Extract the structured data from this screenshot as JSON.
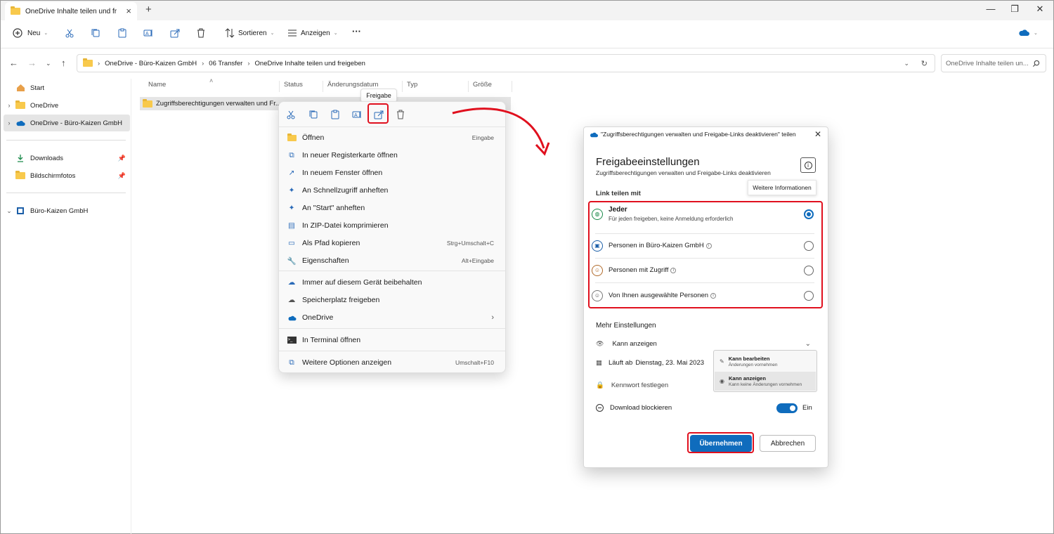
{
  "window": {
    "tab_title": "OneDrive Inhalte teilen und fr",
    "minimize": "—",
    "maximize": "❐",
    "close": "✕"
  },
  "toolbar": {
    "new_label": "Neu",
    "sort_label": "Sortieren",
    "view_label": "Anzeigen",
    "more_label": "···"
  },
  "address": {
    "crumbs": [
      "OneDrive - Büro-Kaizen GmbH",
      "06 Transfer",
      "OneDrive Inhalte teilen und freigeben"
    ],
    "search_placeholder": "OneDrive Inhalte teilen un..."
  },
  "sidebar": {
    "items": [
      {
        "label": "Start"
      },
      {
        "label": "OneDrive"
      },
      {
        "label": "OneDrive - Büro-Kaizen GmbH"
      },
      {
        "label": "Downloads"
      },
      {
        "label": "Bildschirmfotos"
      },
      {
        "label": "Büro-Kaizen GmbH"
      }
    ]
  },
  "filelist": {
    "columns": [
      "Name",
      "Status",
      "Änderungsdatum",
      "Typ",
      "Größe"
    ],
    "rows": [
      {
        "name": "Zugriffsberechtigungen verwalten und Fr..."
      }
    ]
  },
  "tooltip": "Freigabe",
  "context_menu": {
    "items": [
      {
        "label": "Öffnen",
        "shortcut": "Eingabe"
      },
      {
        "label": "In neuer Registerkarte öffnen",
        "shortcut": ""
      },
      {
        "label": "In neuem Fenster öffnen",
        "shortcut": ""
      },
      {
        "label": "An Schnellzugriff anheften",
        "shortcut": ""
      },
      {
        "label": "An \"Start\" anheften",
        "shortcut": ""
      },
      {
        "label": "In ZIP-Datei komprimieren",
        "shortcut": ""
      },
      {
        "label": "Als Pfad kopieren",
        "shortcut": "Strg+Umschalt+C"
      },
      {
        "label": "Eigenschaften",
        "shortcut": "Alt+Eingabe"
      },
      {
        "label": "Immer auf diesem Gerät beibehalten",
        "shortcut": ""
      },
      {
        "label": "Speicherplatz freigeben",
        "shortcut": ""
      },
      {
        "label": "OneDrive",
        "shortcut": ""
      },
      {
        "label": "In Terminal öffnen",
        "shortcut": ""
      },
      {
        "label": "Weitere Optionen anzeigen",
        "shortcut": "Umschalt+F10"
      }
    ]
  },
  "dialog": {
    "title": "\"Zugriffsberechtigungen verwalten und Freigabe-Links deaktivieren\" teilen",
    "heading": "Freigabeeinstellungen",
    "subheading": "Zugriffsberechtigungen verwalten und Freigabe-Links deaktivieren",
    "info_tooltip": "Weitere Informationen",
    "link_share_label": "Link teilen mit",
    "options": [
      {
        "label": "Jeder",
        "sub": "Für jeden freigeben, keine Anmeldung erforderlich",
        "selected": true
      },
      {
        "label": "Personen in Büro-Kaizen GmbH",
        "sub": "",
        "selected": false
      },
      {
        "label": "Personen mit Zugriff",
        "sub": "",
        "selected": false
      },
      {
        "label": "Von Ihnen ausgewählte Personen",
        "sub": "",
        "selected": false
      }
    ],
    "more_settings": "Mehr Einstellungen",
    "permission_value": "Kann anzeigen",
    "expiry_label": "Läuft ab",
    "expiry_value": "Dienstag, 23. Mai 2023",
    "password_label": "Kennwort festlegen",
    "download_block_label": "Download blockieren",
    "toggle_state": "Ein",
    "apply_button": "Übernehmen",
    "cancel_button": "Abbrechen",
    "dropdown": [
      {
        "label": "Kann bearbeiten",
        "sub": "Änderungen vornehmen"
      },
      {
        "label": "Kann anzeigen",
        "sub": "Kann keine Änderungen vornehmen"
      }
    ]
  },
  "colors": {
    "accent": "#0f6cbd",
    "highlight": "#e0101e",
    "folder": "#f8c94c"
  }
}
